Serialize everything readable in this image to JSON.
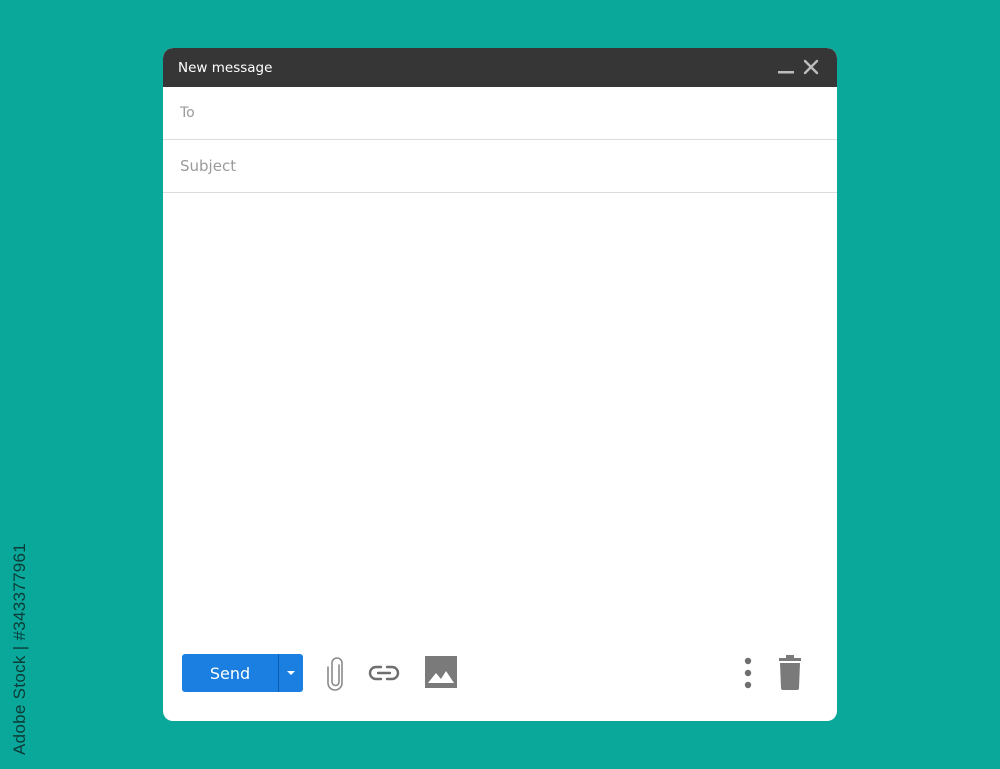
{
  "window": {
    "title": "New message"
  },
  "compose": {
    "to_placeholder": "To",
    "subject_placeholder": "Subject",
    "to_value": "",
    "subject_value": "",
    "body_value": ""
  },
  "toolbar": {
    "send_label": "Send",
    "send_menu_icon": "caret-down-icon",
    "attach_icon": "paperclip-icon",
    "link_icon": "link-icon",
    "photo_icon": "image-icon",
    "more_icon": "more-vertical-icon",
    "trash_icon": "trash-icon"
  },
  "watermark": {
    "side_text": "Adobe Stock | #343377961"
  },
  "colors": {
    "background": "#0aa89b",
    "titlebar": "#363636",
    "send_button": "#1a7fe0",
    "icon_gray": "#7a7a7a"
  }
}
